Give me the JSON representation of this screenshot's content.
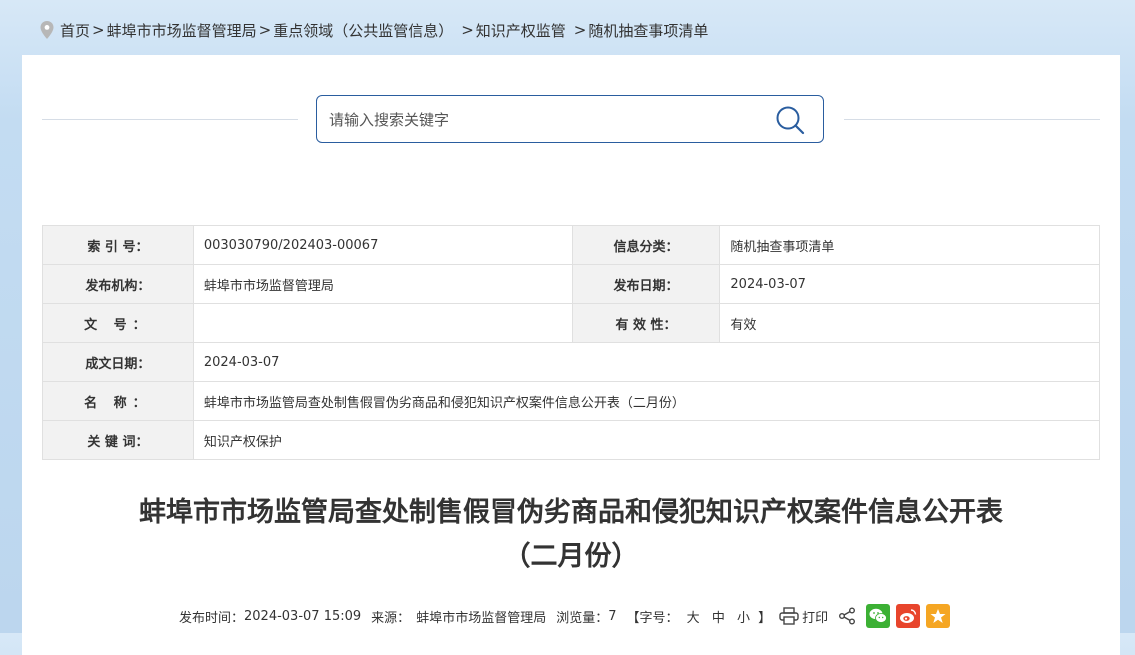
{
  "breadcrumb": {
    "items": [
      {
        "label": "首页"
      },
      {
        "label": "蚌埠市市场监督管理局"
      },
      {
        "label": "重点领域（公共监管信息）"
      },
      {
        "label": "知识产权监管"
      },
      {
        "label": "随机抽查事项清单"
      }
    ]
  },
  "search": {
    "placeholder": "请输入搜索关键字"
  },
  "info_table": {
    "index_label": "索 引 号：",
    "index_value": "003030790/202403-00067",
    "category_label": "信息分类：",
    "category_value": "随机抽查事项清单",
    "publisher_label": "发布机构：",
    "publisher_value": "蚌埠市市场监督管理局",
    "pubdate_label": "发布日期：",
    "pubdate_value": "2024-03-07",
    "docno_label": "文 号：",
    "docno_value": "",
    "validity_label": "有 效 性：",
    "validity_value": "有效",
    "created_label": "成文日期：",
    "created_value": "2024-03-07",
    "name_label": "名 称：",
    "name_value": "蚌埠市市场监管局查处制售假冒伪劣商品和侵犯知识产权案件信息公开表（二月份）",
    "keywords_label": "关 键 词：",
    "keywords_value": "知识产权保护"
  },
  "article": {
    "title_line1": "蚌埠市市场监管局查处制售假冒伪劣商品和侵犯知识产权案件信息公开表",
    "title_line2": "（二月份）"
  },
  "meta_bar": {
    "publish_time_label": "发布时间：",
    "publish_time": "2024-03-07 15:09",
    "source_label": "来源：",
    "source": "蚌埠市市场监督管理局",
    "views_label": "浏览量：",
    "views": "7",
    "font_size_label": "【字号：",
    "font_large": "大",
    "font_medium": "中",
    "font_small": "小",
    "font_size_close": "】",
    "print_label": "打印"
  },
  "icons": {
    "location": "location-pin-icon",
    "search": "search-icon",
    "print": "printer-icon",
    "share": "share-icon",
    "wechat": "wechat-icon",
    "weibo": "weibo-icon",
    "favorite": "star-icon"
  },
  "colors": {
    "accent": "#2a5d9f",
    "wechat": "#3cb034",
    "weibo": "#e8452c",
    "favorite": "#f5a623"
  }
}
